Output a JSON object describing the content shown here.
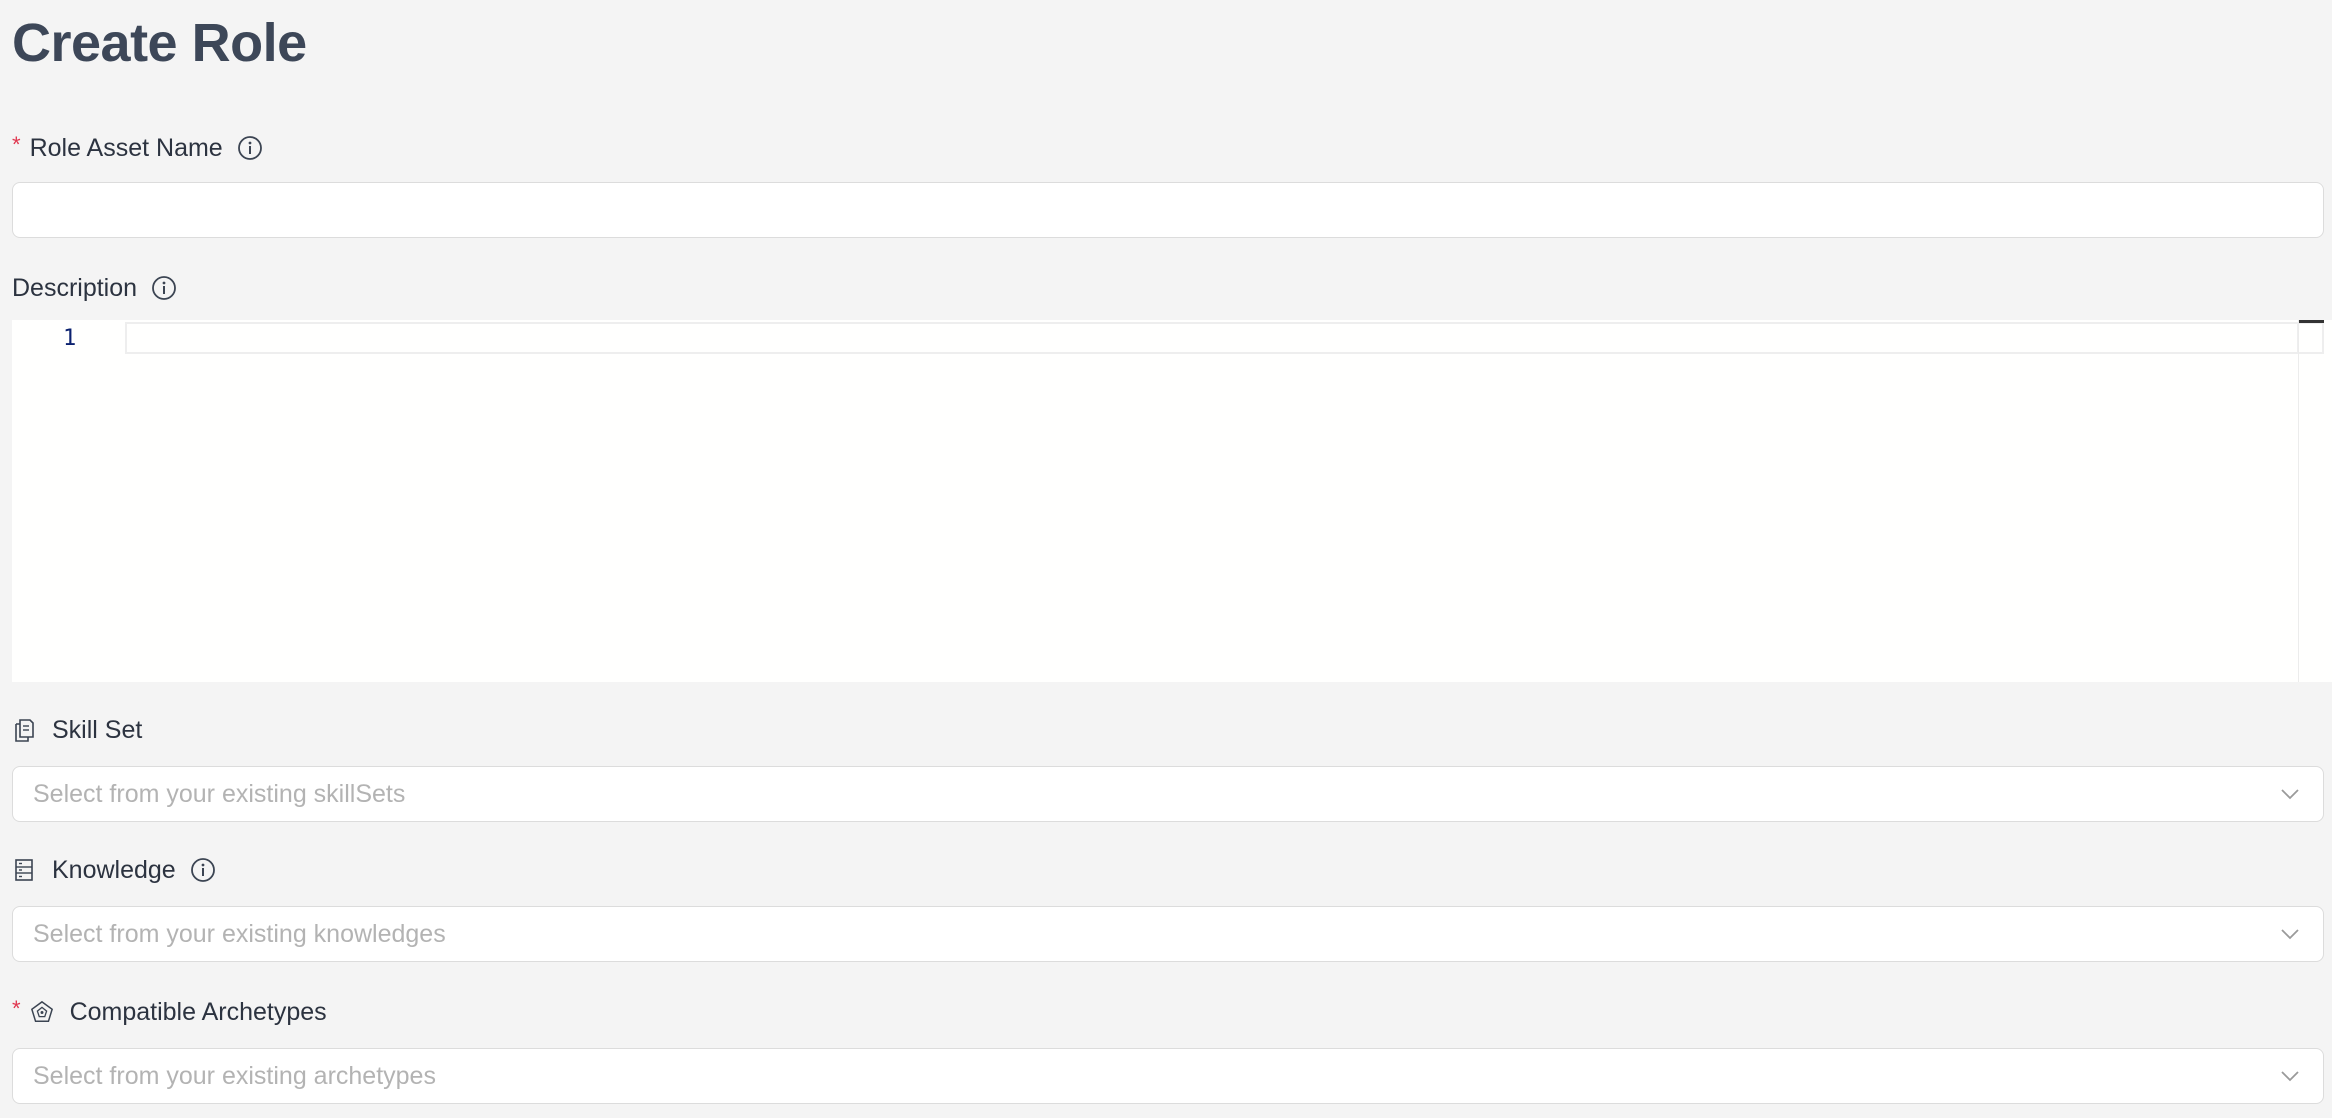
{
  "page": {
    "title": "Create Role"
  },
  "fields": {
    "role_asset_name": {
      "label": "Role Asset Name",
      "required": "*",
      "value": "",
      "placeholder": ""
    },
    "description": {
      "label": "Description",
      "line_number": "1"
    },
    "skill_set": {
      "label": "Skill Set",
      "placeholder": "Select from your existing skillSets"
    },
    "knowledge": {
      "label": "Knowledge",
      "placeholder": "Select from your existing knowledges"
    },
    "compatible_archetypes": {
      "label": "Compatible Archetypes",
      "required": "*",
      "placeholder": "Select from your existing archetypes"
    }
  },
  "icons": {
    "info": "info-circle-icon",
    "skill_set": "copy-documents-icon",
    "knowledge": "database-list-icon",
    "archetypes": "gear-pentagon-icon",
    "dropdown": "chevron-down-icon"
  },
  "colors": {
    "background": "#f4f4f4",
    "title": "#3d4758",
    "required": "#e0364f",
    "placeholder": "#b3b3b3",
    "line_number": "#0b216f"
  }
}
